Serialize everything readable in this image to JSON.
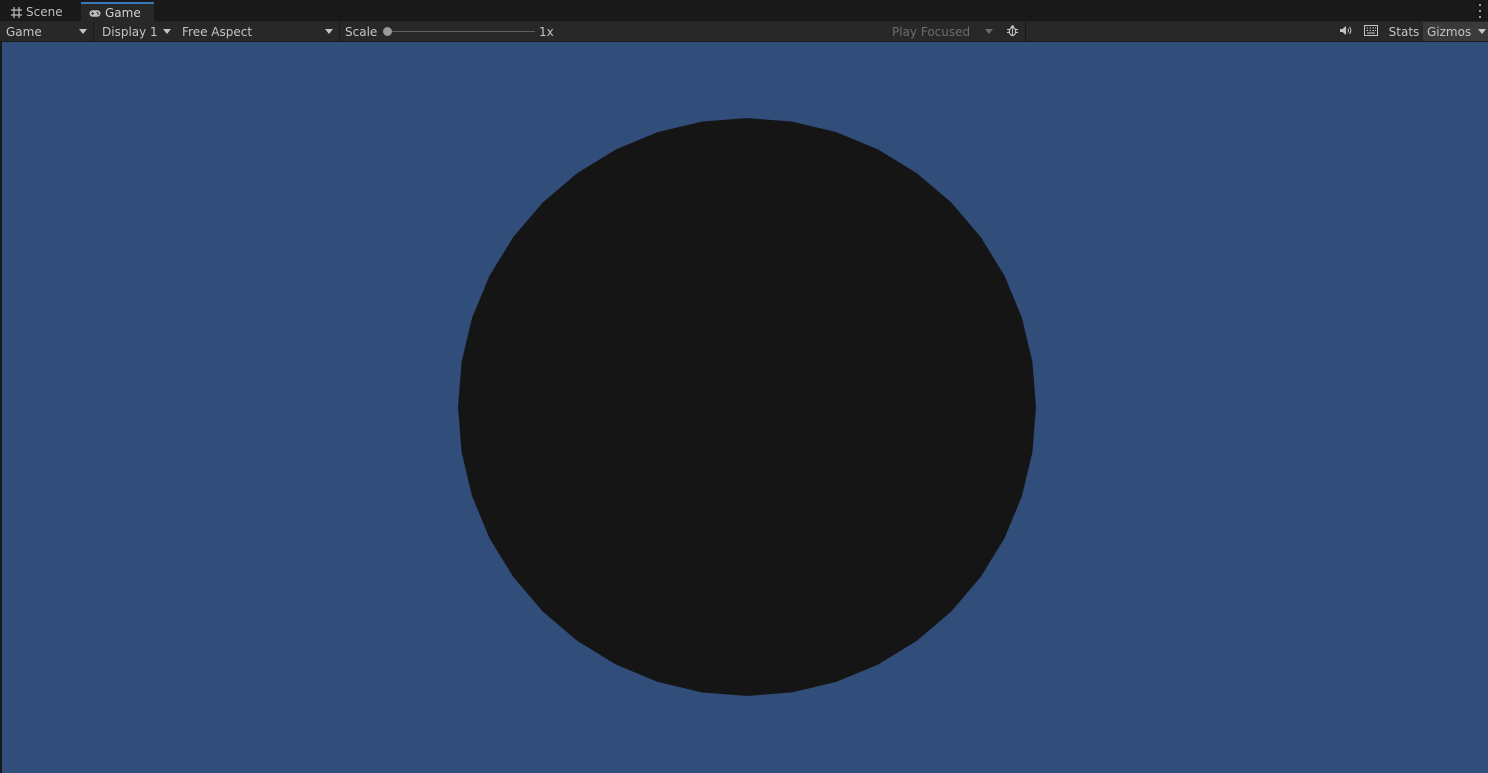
{
  "tabs": [
    {
      "label": "Scene",
      "icon": "grid-icon",
      "active": false
    },
    {
      "label": "Game",
      "icon": "gamepad-icon",
      "active": true
    }
  ],
  "toolbar": {
    "view_dropdown": "Game",
    "display_dropdown": "Display 1",
    "aspect_dropdown": "Free Aspect",
    "scale_label": "Scale",
    "scale_value": "1x",
    "play_mode_dropdown": "Play Focused",
    "stats_label": "Stats",
    "gizmos_label": "Gizmos",
    "icons": {
      "debug": "bug-icon",
      "audio": "speaker-icon",
      "stats": "keyboard-icon"
    }
  },
  "viewport": {
    "background_color": "#314d79",
    "object": {
      "shape": "circle",
      "color": "#151515"
    }
  },
  "colors": {
    "active_tab_accent": "#3a79bb",
    "toolbar_bg": "#282828",
    "window_bg": "#191919"
  }
}
